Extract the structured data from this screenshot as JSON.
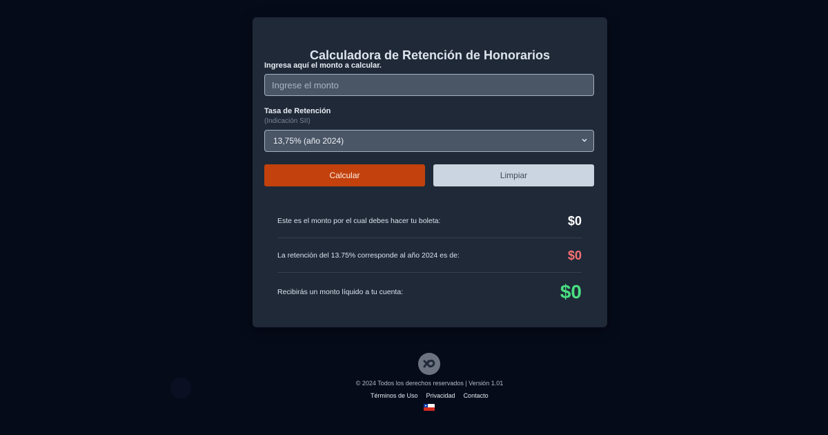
{
  "calculator": {
    "title": "Calculadora de Retención de Honorarios",
    "amount_label": "Ingresa aquí el monto a calcular.",
    "amount_placeholder": "Ingrese el monto",
    "amount_value": "",
    "rate_label": "Tasa de Retención",
    "rate_sublabel": "(Indicación SII)",
    "rate_selected": "13,75% (año 2024)",
    "calc_button": "Calcular",
    "clear_button": "Limpiar"
  },
  "results": [
    {
      "text": "Este es el monto por el cual debes hacer tu boleta:",
      "value": "$0",
      "color": "#ffffff"
    },
    {
      "text": "La retención del 13.75% corresponde al año 2024 es de:",
      "value": "$0",
      "color": "#f87171"
    },
    {
      "text": "Recibirás un monto líquido a tu cuenta:",
      "value": "$0",
      "color": "#4ade80"
    }
  ],
  "footer": {
    "copyright": "© 2024 Todos los derechos reservados | Versión 1.01",
    "links": [
      "Términos de Uso",
      "Privacidad",
      "Contacto"
    ],
    "logo_icon": "brand-logo-icon",
    "flag_icon": "chile-flag-icon"
  },
  "colors": {
    "background": "#060b1a",
    "card": "#1f2938",
    "accent": "#c2410c",
    "secondary_button": "#cbd5e1"
  }
}
